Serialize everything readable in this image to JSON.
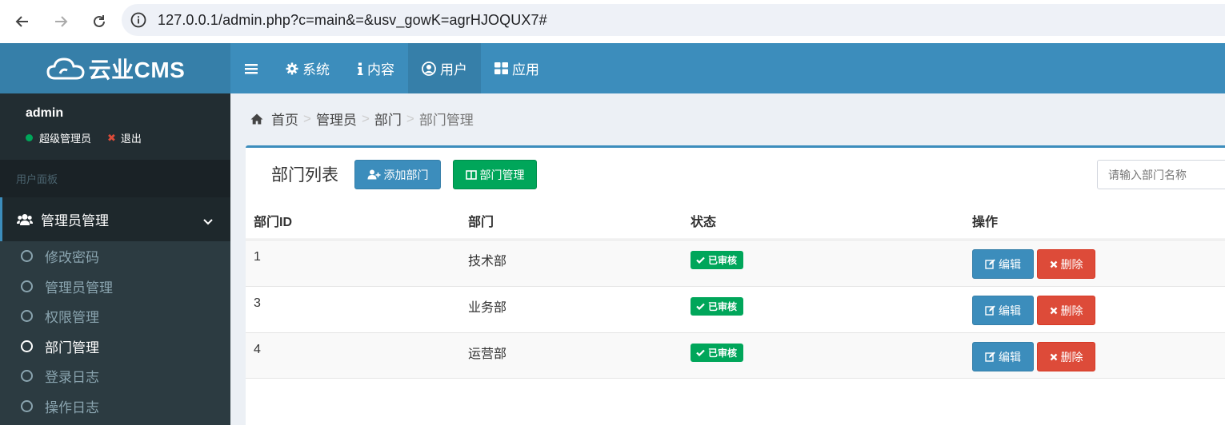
{
  "browser": {
    "url": "127.0.0.1/admin.php?c=main&=&usv_gowK=agrHJOQUX7#"
  },
  "header": {
    "logo_text": "云业CMS",
    "nav": [
      {
        "label": "系统",
        "icon": "gear-icon"
      },
      {
        "label": "内容",
        "icon": "info-icon"
      },
      {
        "label": "用户",
        "icon": "user-circle-icon",
        "active": true
      },
      {
        "label": "应用",
        "icon": "grid-icon"
      }
    ]
  },
  "sidebar": {
    "user_name": "admin",
    "role": "超级管理员",
    "logout": "退出",
    "section_header": "用户面板",
    "active_menu": "管理员管理",
    "submenu": [
      {
        "label": "修改密码"
      },
      {
        "label": "管理员管理"
      },
      {
        "label": "权限管理"
      },
      {
        "label": "部门管理",
        "current": true
      },
      {
        "label": "登录日志"
      },
      {
        "label": "操作日志"
      }
    ]
  },
  "breadcrumb": [
    "首页",
    "管理员",
    "部门",
    "部门管理"
  ],
  "panel": {
    "title": "部门列表",
    "add_button": "添加部门",
    "manage_button": "部门管理",
    "search_placeholder": "请输入部门名称"
  },
  "table": {
    "headers": [
      "部门ID",
      "部门",
      "状态",
      "操作"
    ],
    "rows": [
      {
        "id": "1",
        "name": "技术部",
        "status": "已审核",
        "edit": "编辑",
        "delete": "删除"
      },
      {
        "id": "3",
        "name": "业务部",
        "status": "已审核",
        "edit": "编辑",
        "delete": "删除"
      },
      {
        "id": "4",
        "name": "运营部",
        "status": "已审核",
        "edit": "编辑",
        "delete": "删除"
      }
    ]
  },
  "colors": {
    "primary": "#3c8dbc",
    "success": "#00a65a",
    "danger": "#dd4b39",
    "sidebar": "#222d32"
  }
}
